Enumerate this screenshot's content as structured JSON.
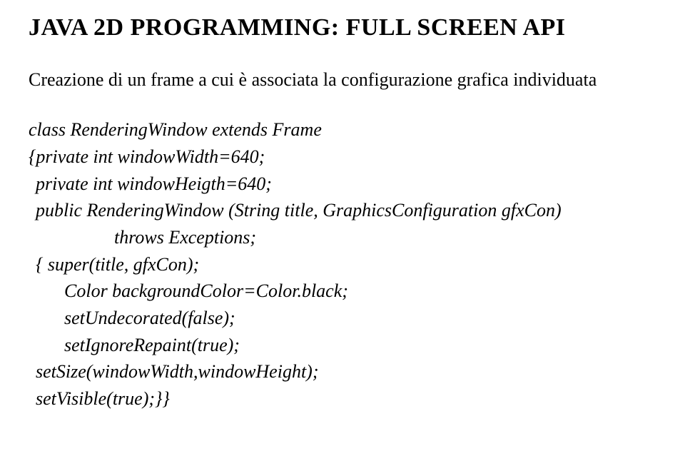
{
  "title": "JAVA 2D PROGRAMMING: FULL SCREEN API",
  "intro": "Creazione di un frame a cui è associata la configurazione grafica individuata",
  "code": {
    "l1": "class RenderingWindow extends Frame",
    "l2": "{private int windowWidth=640;",
    "l3": "private int windowHeigth=640;",
    "l4": "public RenderingWindow (String title, GraphicsConfiguration gfxCon)",
    "l5": "throws Exceptions;",
    "l6": "{ super(title, gfxCon);",
    "l7": "Color backgroundColor=Color.black;",
    "l8": "setUndecorated(false);",
    "l9": "setIgnoreRepaint(true);",
    "l10": "setSize(windowWidth,windowHeight);",
    "l11": "setVisible(true);}}"
  }
}
